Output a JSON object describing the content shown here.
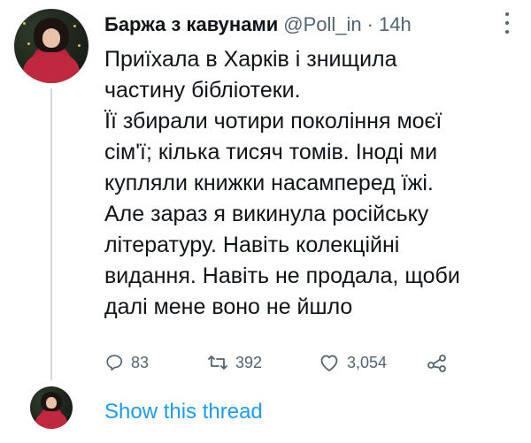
{
  "tweet": {
    "author_name": "Баржа з кавунами",
    "handle": "@Poll_in",
    "separator": "·",
    "time": "14h",
    "text": "Приїхала в Харків і знищила\nчастину бібліотеки.\nЇї збирали чотири покоління моєї\nсім'ї; кілька тисяч томів. Іноді ми\nкупляли книжки насамперед їжі.\nАле зараз я викинула російську\nлітературу. Навіть колекційні\nвидання. Навіть не продала, щоби\nдалі мене воно не йшло",
    "avatar_icon": "profile-avatar"
  },
  "actions": {
    "replies": "83",
    "retweets": "392",
    "likes": "3,054",
    "reply_icon": "reply-icon",
    "retweet_icon": "retweet-icon",
    "like_icon": "heart-icon",
    "share_icon": "share-icon"
  },
  "footer": {
    "show_thread": "Show this thread"
  },
  "colors": {
    "link": "#1d9bf0",
    "secondary_text": "#536471",
    "thread_line": "#cfd9de"
  }
}
